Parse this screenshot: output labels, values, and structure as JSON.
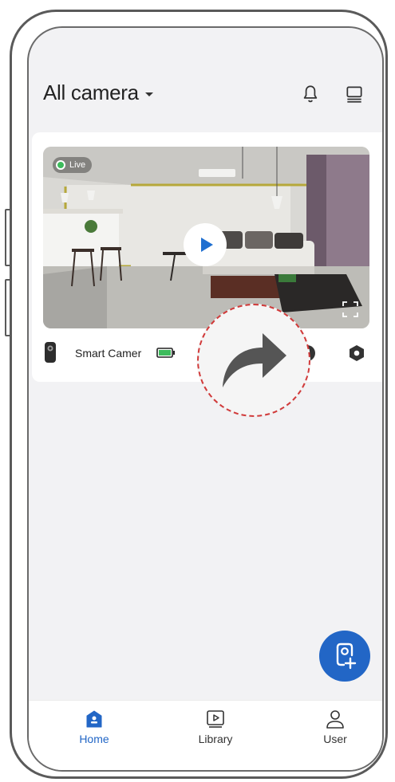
{
  "header": {
    "title": "All camera"
  },
  "camera_card": {
    "live_label": "Live",
    "device_name": "Smart Camer"
  },
  "bottom_nav": {
    "items": [
      {
        "label": "Home",
        "icon": "home-icon",
        "active": true
      },
      {
        "label": "Library",
        "icon": "play-box-icon",
        "active": false
      },
      {
        "label": "User",
        "icon": "person-icon",
        "active": false
      }
    ]
  },
  "colors": {
    "accent": "#2266c6",
    "live": "#3dbb5c",
    "battery": "#3dbb5c",
    "callout_border": "#d13a3a"
  },
  "icons": {
    "header": [
      "bell-icon",
      "devices-icon"
    ],
    "card": [
      "play-icon",
      "fullscreen-icon",
      "camera-device-icon",
      "battery-icon",
      "share-icon",
      "settings-icon"
    ],
    "fab": "add-camera-icon"
  }
}
